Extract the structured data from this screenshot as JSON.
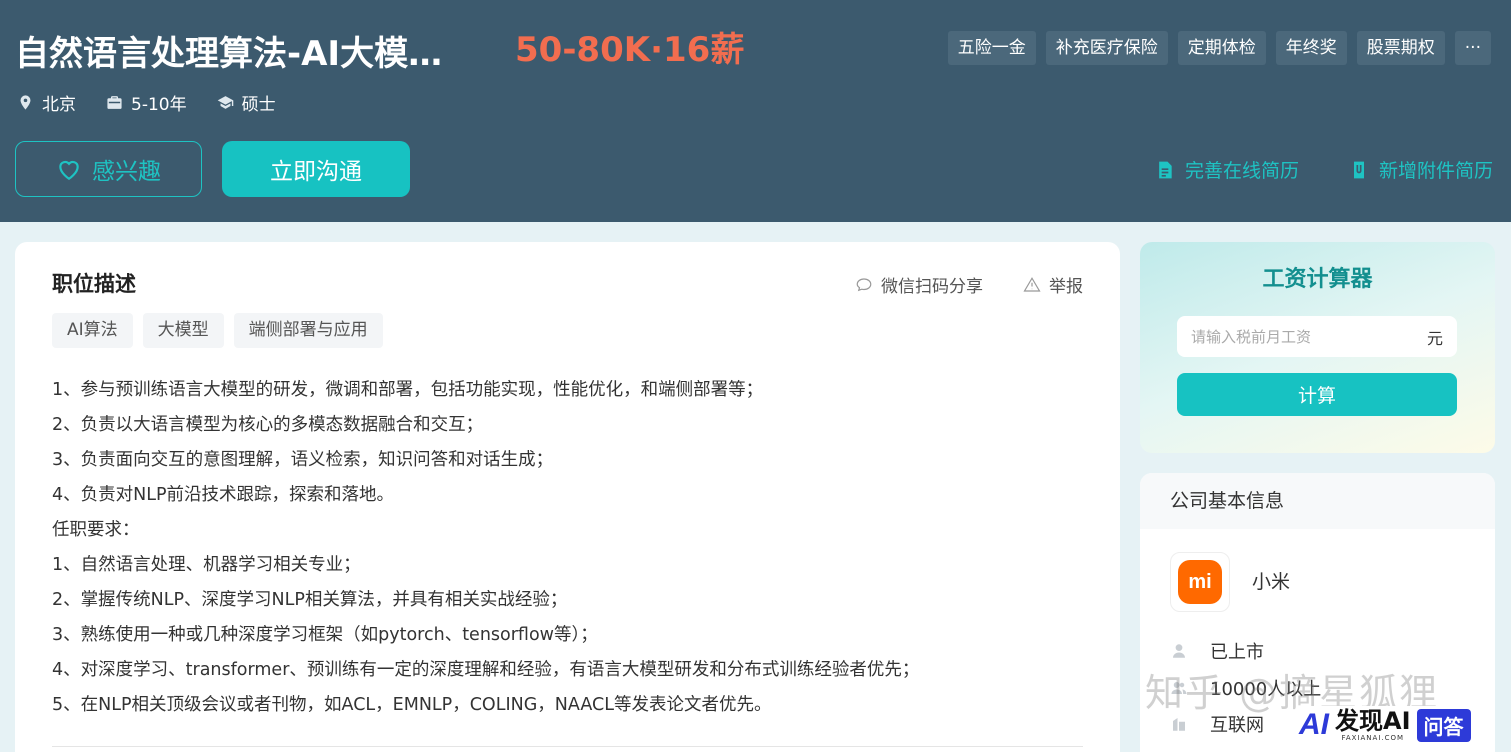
{
  "job": {
    "title": "自然语言处理算法-AI大模…",
    "salary": "50-80K·16薪",
    "benefits": [
      "五险一金",
      "补充医疗保险",
      "定期体检",
      "年终奖",
      "股票期权",
      "···"
    ],
    "location": "北京",
    "experience": "5-10年",
    "degree": "硕士"
  },
  "actions": {
    "interest_label": "感兴趣",
    "chat_label": "立即沟通",
    "complete_resume": "完善在线简历",
    "add_attachment": "新增附件简历"
  },
  "description": {
    "title": "职位描述",
    "share": "微信扫码分享",
    "report": "举报",
    "skills": [
      "AI算法",
      "大模型",
      "端侧部署与应用"
    ],
    "lines": [
      "1、参与预训练语言大模型的研发，微调和部署，包括功能实现，性能优化，和端侧部署等；",
      "2、负责以大语言模型为核心的多模态数据融合和交互；",
      "3、负责面向交互的意图理解，语义检索，知识问答和对话生成；",
      "4、负责对NLP前沿技术跟踪，探索和落地。",
      "任职要求：",
      "1、自然语言处理、机器学习相关专业；",
      "2、掌握传统NLP、深度学习NLP相关算法，并具有相关实战经验；",
      "3、熟练使用一种或几种深度学习框架（如pytorch、tensorflow等）；",
      "4、对深度学习、transformer、预训练有一定的深度理解和经验，有语言大模型研发和分布式训练经验者优先；",
      "5、在NLP相关顶级会议或者刊物，如ACL，EMNLP，COLING，NAACL等发表论文者优先。"
    ]
  },
  "calculator": {
    "title": "工资计算器",
    "placeholder": "请输入税前月工资",
    "unit": "元",
    "button": "计算"
  },
  "company": {
    "heading": "公司基本信息",
    "logo_text": "mi",
    "name": "小米",
    "listing": "已上市",
    "size": "10000人以上",
    "industry": "互联网"
  },
  "overlay": {
    "watermark": "知乎 @摘星狐狸",
    "badge_logo": "AI",
    "badge_main": "发现AI",
    "badge_sub": "FAXIANAI.COM",
    "badge_qa": "问答"
  }
}
